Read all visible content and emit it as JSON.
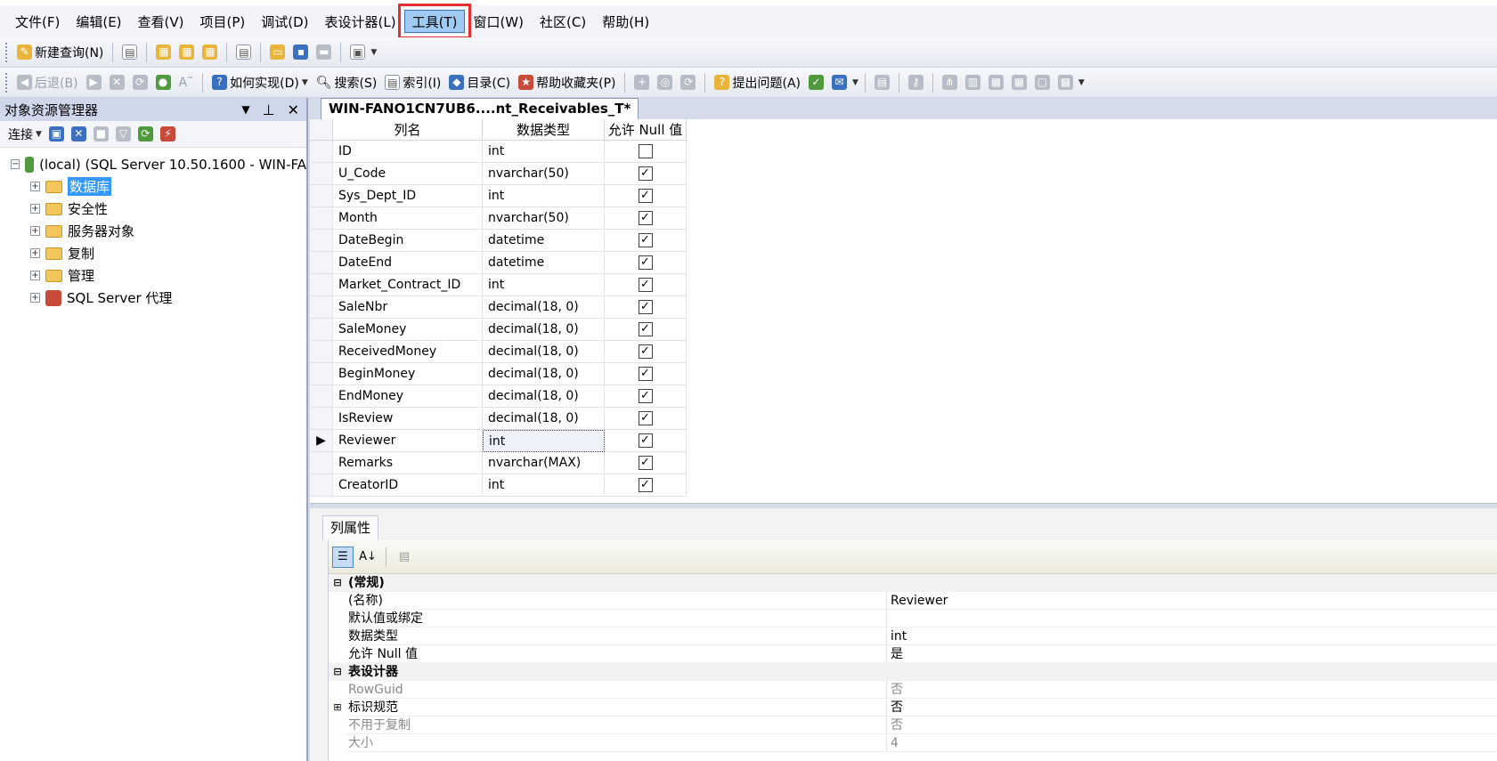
{
  "menu": {
    "items": [
      {
        "label": "文件(F)"
      },
      {
        "label": "编辑(E)"
      },
      {
        "label": "查看(V)"
      },
      {
        "label": "项目(P)"
      },
      {
        "label": "调试(D)"
      },
      {
        "label": "表设计器(L)"
      },
      {
        "label": "工具(T)"
      },
      {
        "label": "窗口(W)"
      },
      {
        "label": "社区(C)"
      },
      {
        "label": "帮助(H)"
      }
    ],
    "highlighted_index": 6
  },
  "toolbar1": {
    "new_query": "新建查询(N)"
  },
  "toolbar2": {
    "back": "后退(B)",
    "how_do_i": "如何实现(D)",
    "search": "搜索(S)",
    "index": "索引(I)",
    "contents": "目录(C)",
    "help_favorites": "帮助收藏夹(P)",
    "ask_question": "提出问题(A)"
  },
  "object_explorer": {
    "title": "对象资源管理器",
    "connect": "连接",
    "server": "(local) (SQL Server 10.50.1600 - WIN-FA",
    "nodes": [
      {
        "label": "数据库"
      },
      {
        "label": "安全性"
      },
      {
        "label": "服务器对象"
      },
      {
        "label": "复制"
      },
      {
        "label": "管理"
      },
      {
        "label": "SQL Server 代理"
      }
    ]
  },
  "document": {
    "tab_title": "WIN-FANO1CN7UB6....nt_Receivables_T*",
    "columns": {
      "name": "列名",
      "type": "数据类型",
      "nullable": "允许 Null 值"
    },
    "rows": [
      {
        "name": "ID",
        "type": "int",
        "nullable": false
      },
      {
        "name": "U_Code",
        "type": "nvarchar(50)",
        "nullable": true
      },
      {
        "name": "Sys_Dept_ID",
        "type": "int",
        "nullable": true
      },
      {
        "name": "Month",
        "type": "nvarchar(50)",
        "nullable": true
      },
      {
        "name": "DateBegin",
        "type": "datetime",
        "nullable": true
      },
      {
        "name": "DateEnd",
        "type": "datetime",
        "nullable": true
      },
      {
        "name": "Market_Contract_ID",
        "type": "int",
        "nullable": true
      },
      {
        "name": "SaleNbr",
        "type": "decimal(18, 0)",
        "nullable": true
      },
      {
        "name": "SaleMoney",
        "type": "decimal(18, 0)",
        "nullable": true
      },
      {
        "name": "ReceivedMoney",
        "type": "decimal(18, 0)",
        "nullable": true
      },
      {
        "name": "BeginMoney",
        "type": "decimal(18, 0)",
        "nullable": true
      },
      {
        "name": "EndMoney",
        "type": "decimal(18, 0)",
        "nullable": true
      },
      {
        "name": "IsReview",
        "type": "decimal(18, 0)",
        "nullable": true
      },
      {
        "name": "Reviewer",
        "type": "int",
        "nullable": true
      },
      {
        "name": "Remarks",
        "type": "nvarchar(MAX)",
        "nullable": true
      },
      {
        "name": "CreatorID",
        "type": "int",
        "nullable": true
      }
    ],
    "current_row_index": 13
  },
  "properties": {
    "tab": "列属性",
    "general_category": "(常规)",
    "name_label": "(名称)",
    "name_value": "Reviewer",
    "default_label": "默认值或绑定",
    "default_value": "",
    "datatype_label": "数据类型",
    "datatype_value": "int",
    "allow_null_label": "允许 Null 值",
    "allow_null_value": "是",
    "designer_category": "表设计器",
    "rowguid_label": "RowGuid",
    "rowguid_value": "否",
    "identity_label": "标识规范",
    "identity_value": "否",
    "not_for_replication_label": "不用于复制",
    "not_for_replication_value": "否",
    "size_label": "大小",
    "size_value": "4"
  },
  "colors": {
    "menu_highlight": "#9fcbf2",
    "callout_red": "#e23030",
    "selection_blue": "#3399ff"
  }
}
